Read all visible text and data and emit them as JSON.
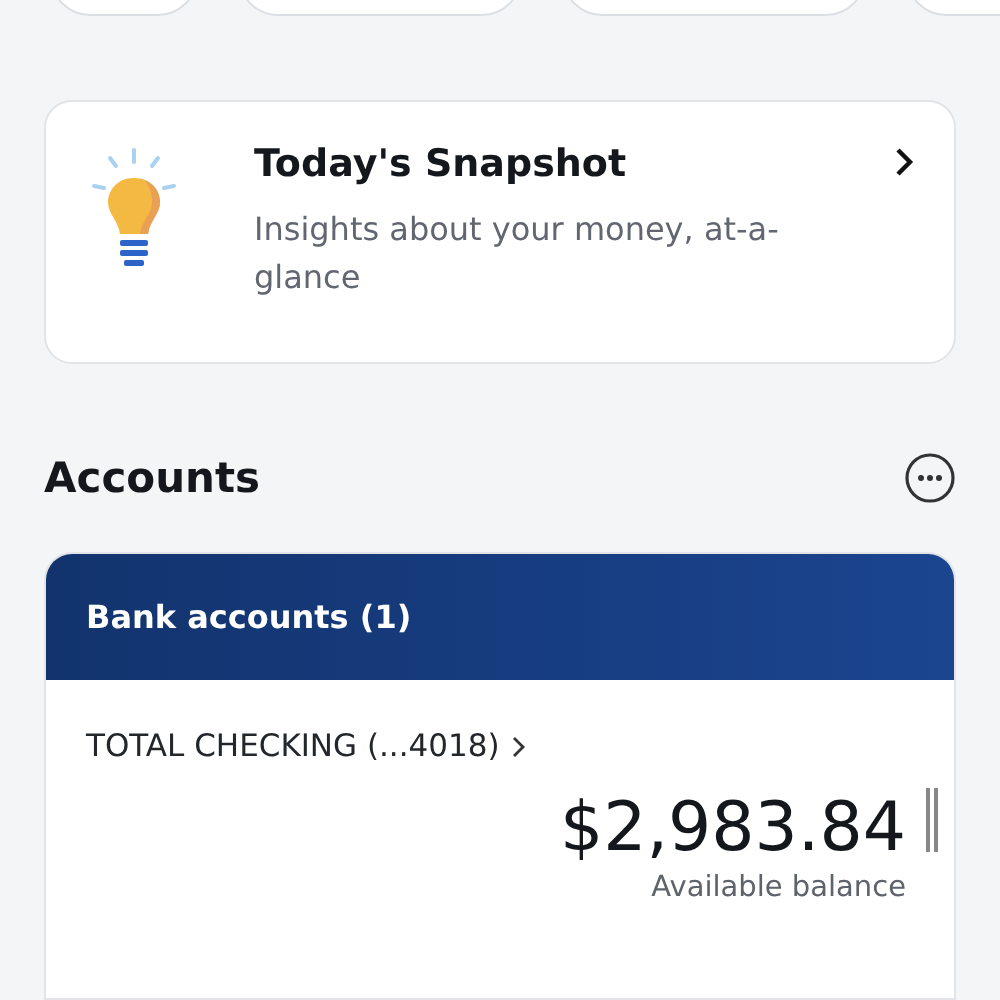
{
  "quick_actions": [
    {
      "kind": "pill"
    },
    {
      "kind": "pill"
    },
    {
      "kind": "pill"
    },
    {
      "kind": "pill"
    }
  ],
  "snapshot": {
    "title": "Today's Snapshot",
    "subtitle": "Insights about your money, at-a-glance"
  },
  "accounts": {
    "title": "Accounts",
    "group": {
      "title": "Bank accounts (1)",
      "account": {
        "name": "TOTAL CHECKING (...4018)",
        "balance": "$2,983.84",
        "balance_label": "Available balance"
      }
    }
  }
}
